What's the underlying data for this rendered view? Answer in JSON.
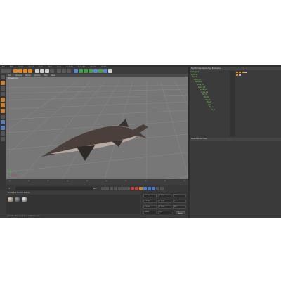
{
  "menubar": {
    "items": [
      "File",
      "Edit",
      "Create",
      "Select",
      "Tools",
      "Mesh",
      "Snap",
      "Animate",
      "Simulate",
      "Render",
      "Sculpt",
      "Motion Tracker",
      "MoGraph",
      "Character",
      "Pipeline",
      "Plugins",
      "Script",
      "Window",
      "Help",
      "Layout:"
    ]
  },
  "viewport": {
    "menu": [
      "View",
      "Cameras",
      "Display",
      "Options",
      "Filter",
      "Panel"
    ],
    "title": "Perspective",
    "background": "#777777",
    "grid_color": "#8a8a8a"
  },
  "timeline": {
    "ticks": [
      "0",
      "5",
      "10",
      "15",
      "20",
      "25",
      "30",
      "35",
      "40",
      "45",
      "50",
      "55",
      "60",
      "65",
      "70",
      "75",
      "80",
      "85",
      "90"
    ]
  },
  "playback": {
    "frame": "0 F",
    "end": "90 F"
  },
  "materials": {
    "menu": [
      "Create",
      "Edit",
      "Function",
      "Texture"
    ]
  },
  "coordinates": {
    "fields": [
      [
        "X 0 cm",
        "X 0 cm",
        "H 0 °"
      ],
      [
        "Y 0 cm",
        "Y 0 cm",
        "P 0 °"
      ],
      [
        "Z 0 cm",
        "Z 0 cm",
        "B 0 °"
      ]
    ],
    "mode_left": "World",
    "mode_mid": "Size",
    "apply": "Apply"
  },
  "object_manager": {
    "menu": [
      "File",
      "Edit",
      "View",
      "Objects",
      "Tags",
      "Bookmarks"
    ],
    "items": [
      "L0 Sturgeon",
      "  L1 Body",
      "   Spine",
      "    Spine_01",
      "     Spine_02",
      "      Spine_03",
      "       Spine_04",
      "        Spine_05",
      "         Spine_06",
      "          Tail_01",
      "           Tail_02",
      "           Tail_03",
      "    Head",
      "     Jaw",
      "   Fin_L",
      "   Fin_R"
    ],
    "accent": "#d98a2b",
    "item_color": "#7fcf5a"
  },
  "attribute_manager": {
    "menu": [
      "Mode",
      "Edit",
      "User Data"
    ]
  },
  "status": {
    "text": "Azimuth: Click and drag to rotate the view"
  }
}
